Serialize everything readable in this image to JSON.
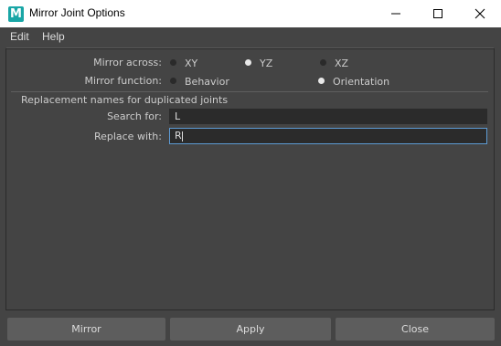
{
  "window": {
    "icon_letter": "M",
    "title": "Mirror Joint Options"
  },
  "menu": [
    "Edit",
    "Help"
  ],
  "mirror_across": {
    "label": "Mirror across:",
    "options": [
      "XY",
      "YZ",
      "XZ"
    ],
    "selected": "YZ"
  },
  "mirror_function": {
    "label": "Mirror function:",
    "options": [
      "Behavior",
      "Orientation"
    ],
    "selected": "Orientation"
  },
  "replacement": {
    "section_title": "Replacement names for duplicated joints",
    "search_label": "Search for:",
    "search_value": "L",
    "replace_label": "Replace with:",
    "replace_value": "R"
  },
  "buttons": {
    "mirror": "Mirror",
    "apply": "Apply",
    "close": "Close"
  },
  "colors": {
    "background": "#444444",
    "field": "#2b2b2b",
    "focus_border": "#5d9bd4",
    "button": "#5d5d5d",
    "icon": "#19a6a6"
  }
}
